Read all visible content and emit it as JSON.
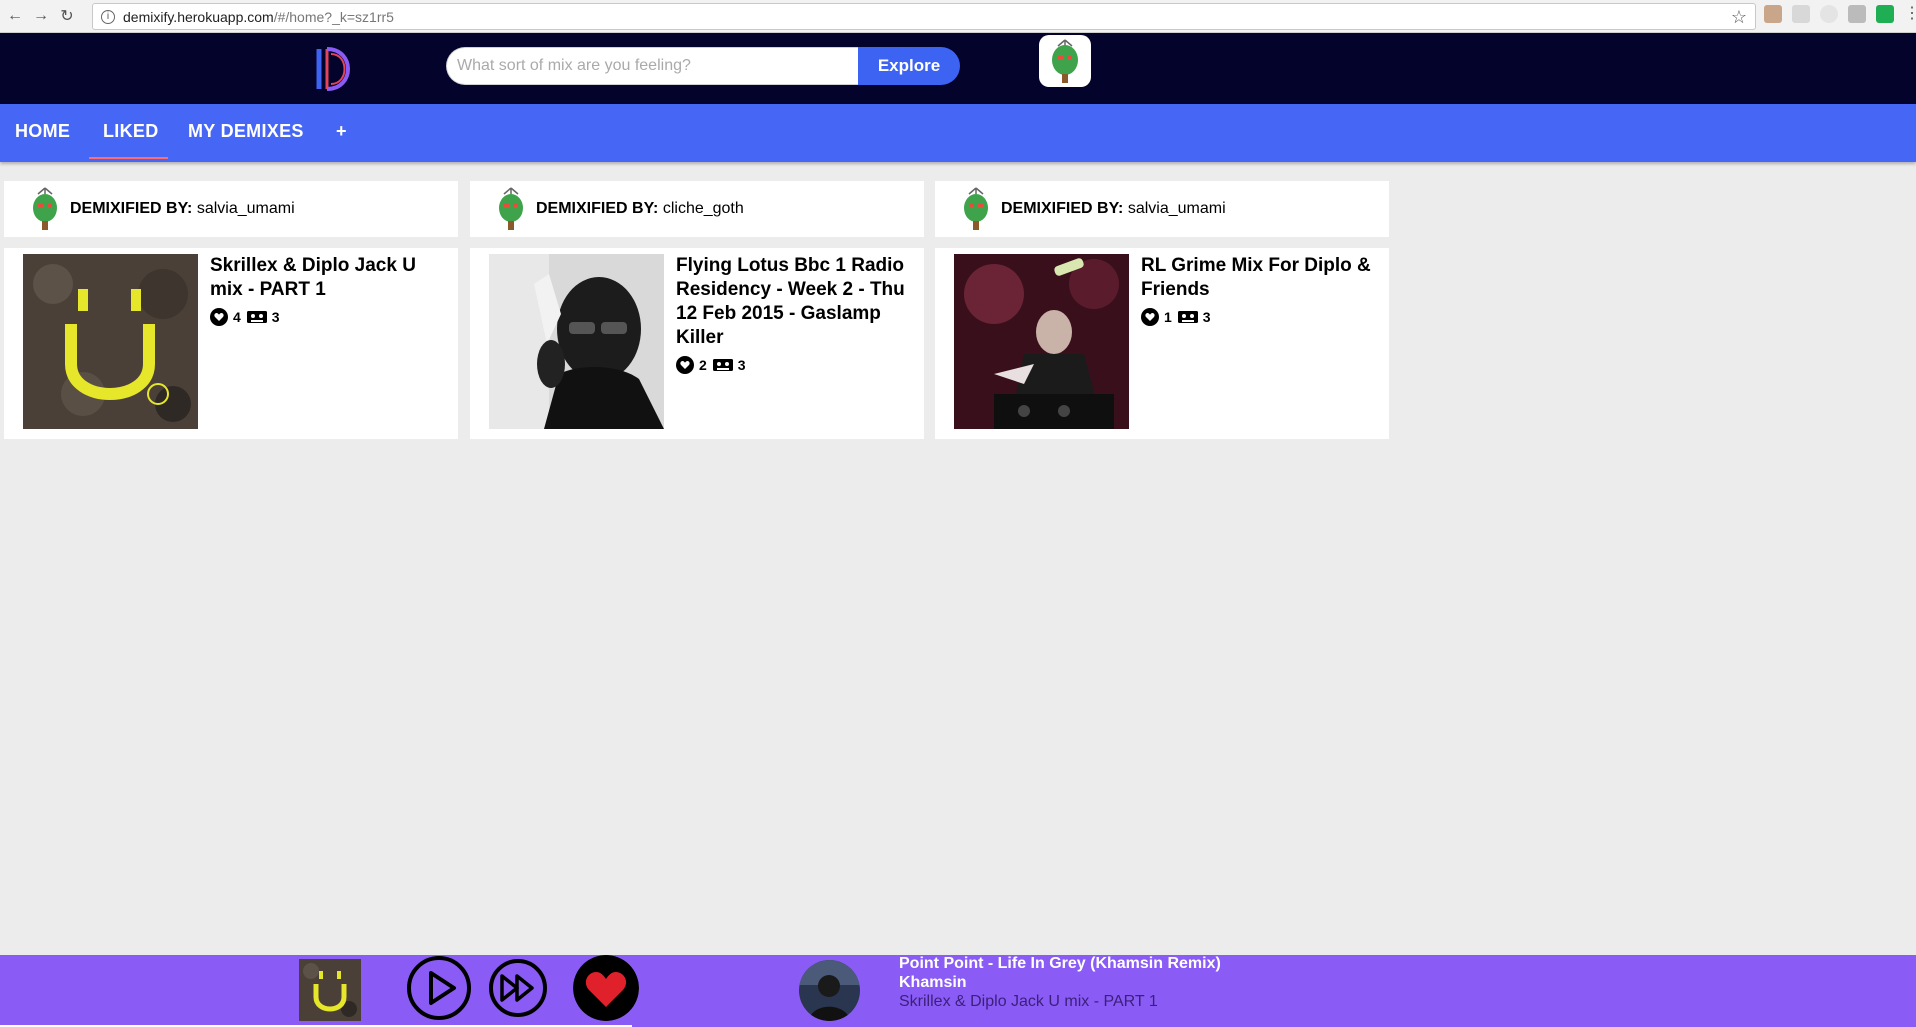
{
  "browser": {
    "url_host": "demixify.herokuapp.com",
    "url_path": "/#/home?_k=sz1rr5"
  },
  "header": {
    "search_placeholder": "What sort of mix are you feeling?",
    "explore_label": "Explore"
  },
  "tabs": [
    {
      "label": "HOME",
      "active": false
    },
    {
      "label": "LIKED",
      "active": true
    },
    {
      "label": "MY DEMIXES",
      "active": false
    },
    {
      "label": "+",
      "active": false
    }
  ],
  "cards": [
    {
      "by_label": "DEMIXIFIED BY:",
      "user": "salvia_umami",
      "title": "Skrillex & Diplo Jack U mix - PART 1",
      "likes": "4",
      "tracks": "3"
    },
    {
      "by_label": "DEMIXIFIED BY:",
      "user": "cliche_goth",
      "title": "Flying Lotus Bbc 1 Radio Residency - Week 2 - Thu 12 Feb 2015 - Gaslamp Killer",
      "likes": "2",
      "tracks": "3"
    },
    {
      "by_label": "DEMIXIFIED BY:",
      "user": "salvia_umami",
      "title": "RL Grime Mix For Diplo & Friends",
      "likes": "1",
      "tracks": "3"
    }
  ],
  "player": {
    "track_title": "Point Point - Life In Grey (Khamsin Remix)",
    "track_artist": "Khamsin",
    "mix_title": "Skrillex & Diplo Jack U mix - PART 1",
    "progress": 0.33
  },
  "colors": {
    "header_bg": "#03032b",
    "tab_bg": "#4666f5",
    "accent": "#3d63f2",
    "player_bg": "#8a5cf5",
    "tab_underline": "#ff6d6d"
  }
}
